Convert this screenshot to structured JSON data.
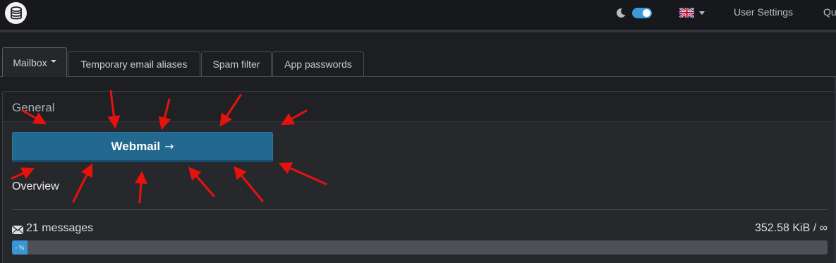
{
  "navbar": {
    "user_settings": "User Settings",
    "truncated_link": "Qu",
    "theme_toggle_state": "on",
    "language_flag": "uk-flag-icon"
  },
  "tabs": [
    {
      "label": "Mailbox",
      "active": true,
      "dropdown": true
    },
    {
      "label": "Temporary email aliases",
      "active": false
    },
    {
      "label": "Spam filter",
      "active": false
    },
    {
      "label": "App passwords",
      "active": false
    }
  ],
  "panel": {
    "title": "General",
    "webmail_button": "Webmail",
    "webmail_arrow": "→",
    "overview_label": "Overview",
    "messages": "21 messages",
    "quota": "352.58 KiB / ∞",
    "progress_label": "- %",
    "progress_percent": 2
  },
  "colors": {
    "accent": "#22688f",
    "toggle": "#3d9ad8",
    "progress_fill": "#3b97d3",
    "annotation_arrows": "#e8120c"
  }
}
